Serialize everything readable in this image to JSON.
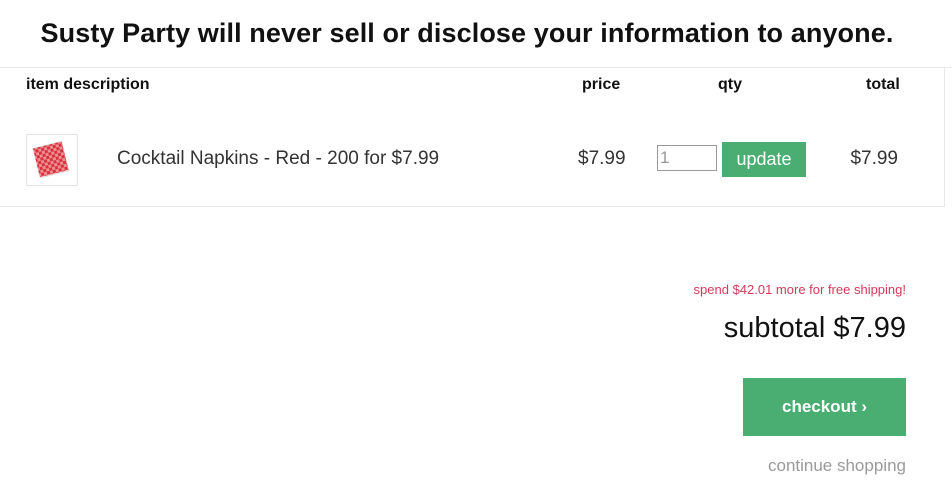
{
  "banner": {
    "title": "Susty Party will never sell or disclose your information to anyone."
  },
  "table": {
    "headers": {
      "description": "item description",
      "price": "price",
      "qty": "qty",
      "total": "total"
    },
    "items": [
      {
        "thumbnail_icon": "red-checkered-napkins-icon",
        "name": "Cocktail Napkins - Red - 200 for $7.99",
        "price": "$7.99",
        "qty": "1",
        "update_label": "update",
        "total": "$7.99"
      }
    ]
  },
  "summary": {
    "shipping_note": "spend $42.01 more for free shipping!",
    "subtotal_label": "subtotal",
    "subtotal_value": "$7.99",
    "checkout_label": "checkout ›",
    "continue_label": "continue shopping"
  },
  "colors": {
    "accent_green": "#4aae72",
    "note_red": "#d23a5a",
    "muted_gray": "#9a9a9a"
  }
}
